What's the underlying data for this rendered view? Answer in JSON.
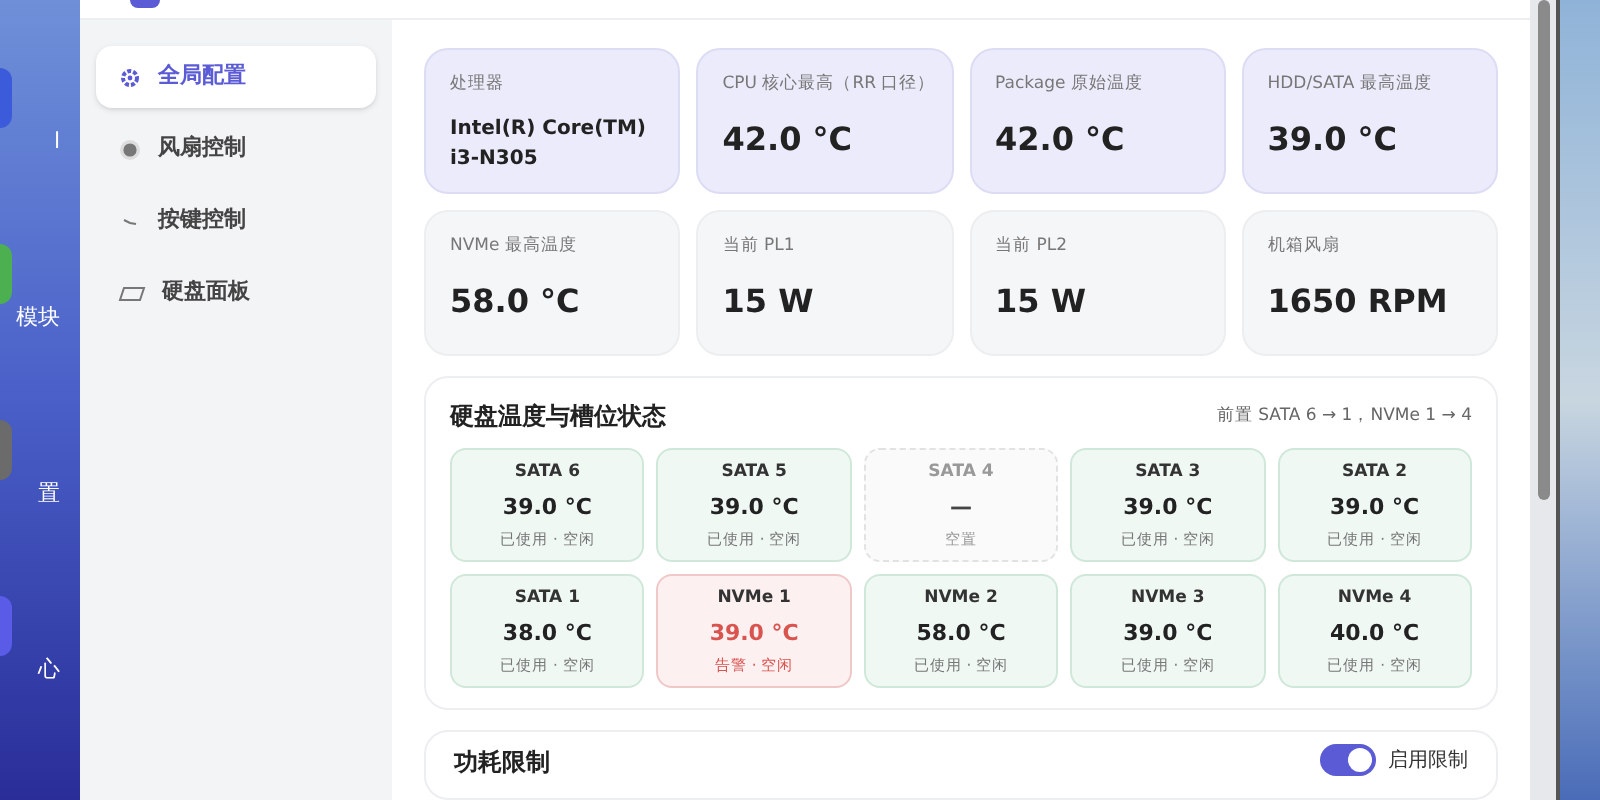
{
  "desktop": {
    "labels": [
      "l",
      "模块",
      "置",
      "心"
    ]
  },
  "sidebar": {
    "items": [
      {
        "label": "全局配置",
        "selected": true
      },
      {
        "label": "风扇控制",
        "selected": false
      },
      {
        "label": "按键控制",
        "selected": false
      },
      {
        "label": "硬盘面板",
        "selected": false
      }
    ]
  },
  "stats": [
    {
      "label": "处理器",
      "value": "Intel(R) Core(TM) i3-N305",
      "kind": "text",
      "highlight": true
    },
    {
      "label": "CPU 核心最高（RR 口径）",
      "value": "42.0 °C",
      "kind": "big",
      "highlight": true
    },
    {
      "label": "Package 原始温度",
      "value": "42.0 °C",
      "kind": "big",
      "highlight": true
    },
    {
      "label": "HDD/SATA 最高温度",
      "value": "39.0 °C",
      "kind": "big",
      "highlight": true
    },
    {
      "label": "NVMe 最高温度",
      "value": "58.0 °C",
      "kind": "big",
      "highlight": false
    },
    {
      "label": "当前 PL1",
      "value": "15 W",
      "kind": "big",
      "highlight": false
    },
    {
      "label": "当前 PL2",
      "value": "15 W",
      "kind": "big",
      "highlight": false
    },
    {
      "label": "机箱风扇",
      "value": "1650 RPM",
      "kind": "big",
      "highlight": false
    }
  ],
  "disk_panel": {
    "title": "硬盘温度与槽位状态",
    "note": "前置 SATA 6 → 1，NVMe 1 → 4",
    "slots": [
      {
        "name": "SATA 6",
        "temp": "39.0 °C",
        "status": "已使用 · 空闲",
        "kind": "used"
      },
      {
        "name": "SATA 5",
        "temp": "39.0 °C",
        "status": "已使用 · 空闲",
        "kind": "used"
      },
      {
        "name": "SATA 4",
        "temp": "—",
        "status": "空置",
        "kind": "empty"
      },
      {
        "name": "SATA 3",
        "temp": "39.0 °C",
        "status": "已使用 · 空闲",
        "kind": "used"
      },
      {
        "name": "SATA 2",
        "temp": "39.0 °C",
        "status": "已使用 · 空闲",
        "kind": "used"
      },
      {
        "name": "SATA 1",
        "temp": "38.0 °C",
        "status": "已使用 · 空闲",
        "kind": "used"
      },
      {
        "name": "NVMe 1",
        "temp": "39.0 °C",
        "status": "告警 · 空闲",
        "kind": "alert"
      },
      {
        "name": "NVMe 2",
        "temp": "58.0 °C",
        "status": "已使用 · 空闲",
        "kind": "used"
      },
      {
        "name": "NVMe 3",
        "temp": "39.0 °C",
        "status": "已使用 · 空闲",
        "kind": "used"
      },
      {
        "name": "NVMe 4",
        "temp": "40.0 °C",
        "status": "已使用 · 空闲",
        "kind": "used"
      }
    ]
  },
  "power_panel": {
    "title": "功耗限制",
    "toggle": {
      "label": "启用限制",
      "on": true
    }
  }
}
